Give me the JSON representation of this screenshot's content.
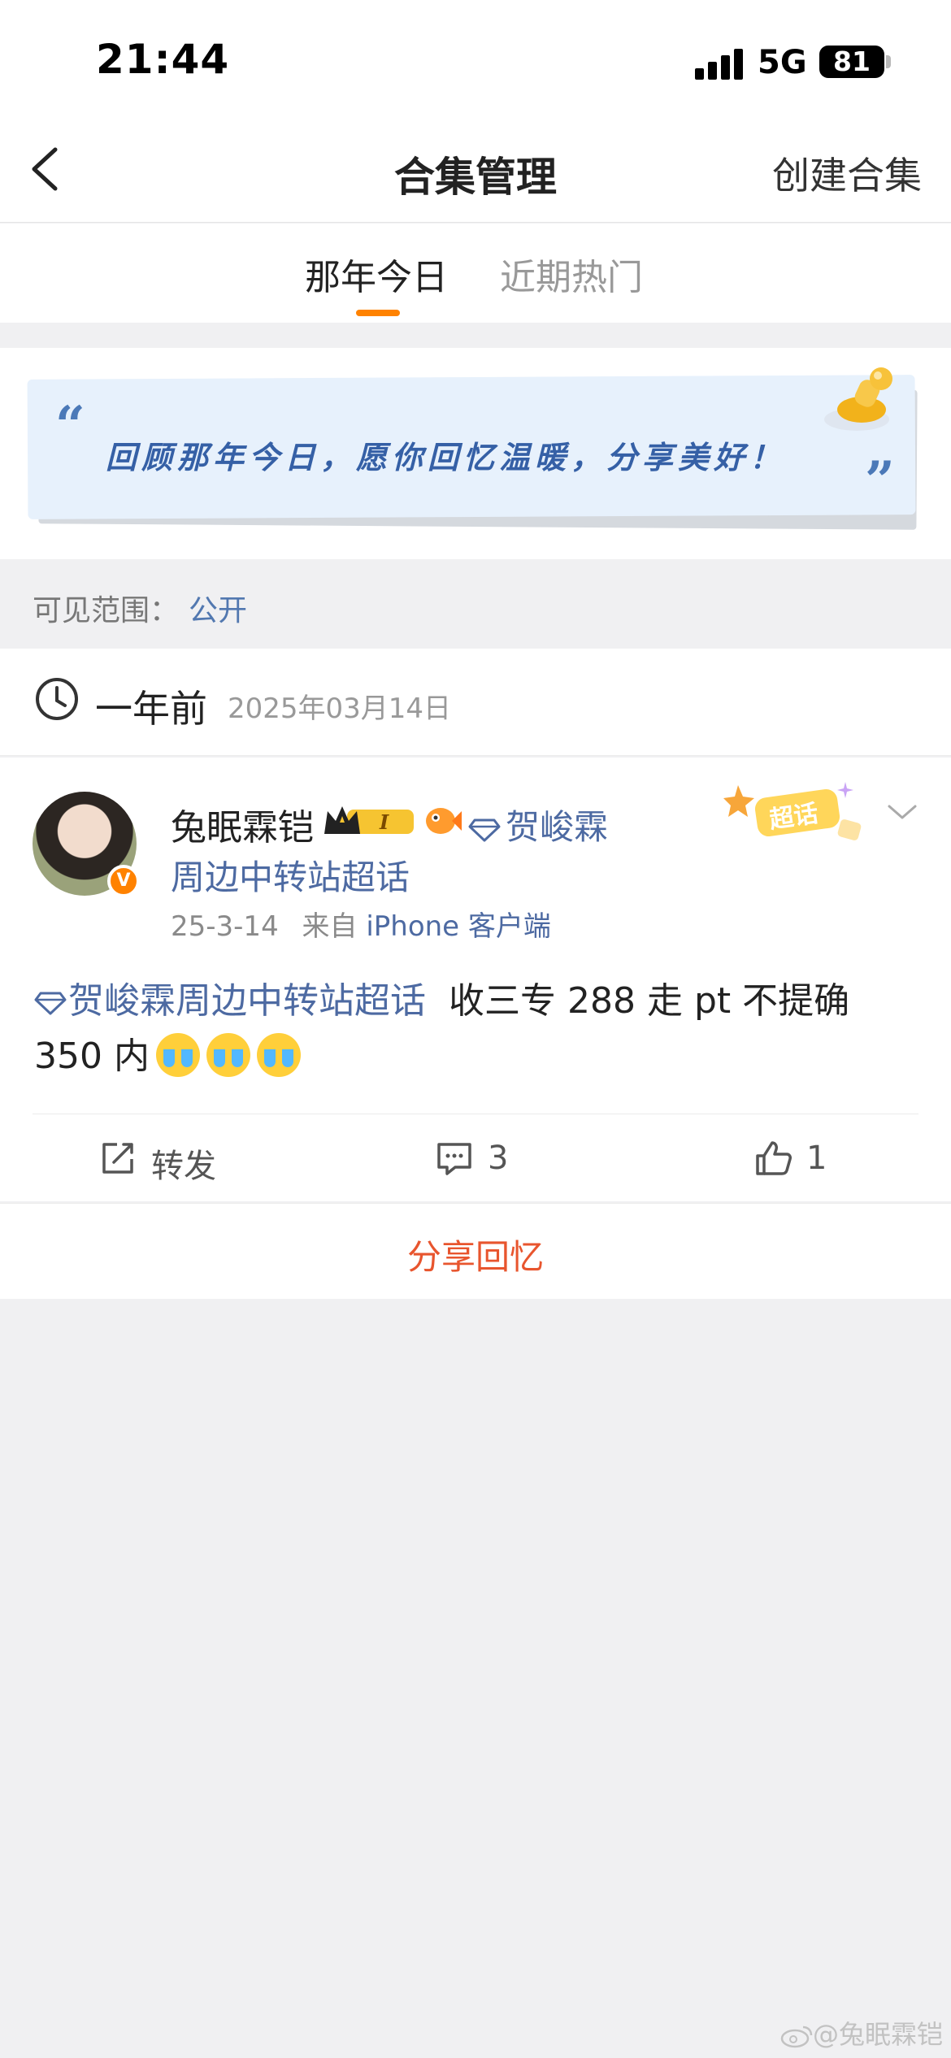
{
  "status_bar": {
    "time": "21:44",
    "network": "5G",
    "battery": "81"
  },
  "nav": {
    "title": "合集管理",
    "right_action": "创建合集",
    "back_icon": "chevron-left-icon"
  },
  "tabs": [
    {
      "label": "那年今日",
      "active": true
    },
    {
      "label": "近期热门",
      "active": false
    }
  ],
  "banner": {
    "open_quote": "“",
    "text": "回顾那年今日，愿你回忆温暖，分享美好！",
    "close_quote": "”"
  },
  "visibility": {
    "label": "可见范围：",
    "value": "公开"
  },
  "memory": {
    "ago": "一年前",
    "date": "2025年03月14日"
  },
  "post": {
    "username": "兔眠霖铠",
    "badge_level": "I",
    "topic_line1": "贺峻霖",
    "topic_line2": "周边中转站超话",
    "meta_date": "25-3-14",
    "meta_from": "来自",
    "meta_source": "iPhone 客户端",
    "chaohua_badge": "超话",
    "verified": "V",
    "content_link": "贺峻霖周边中转站超话",
    "content_text": "收三专 288 走 pt 不提确 350 内",
    "actions": {
      "repost_label": "转发",
      "comment_count": "3",
      "like_count": "1"
    }
  },
  "share": {
    "label": "分享回忆"
  },
  "watermark": "@兔眠霖铠",
  "colors": {
    "accent": "#ff8200",
    "link": "#4d6aa2",
    "share": "#e8552e",
    "background": "#f0f0f2"
  }
}
